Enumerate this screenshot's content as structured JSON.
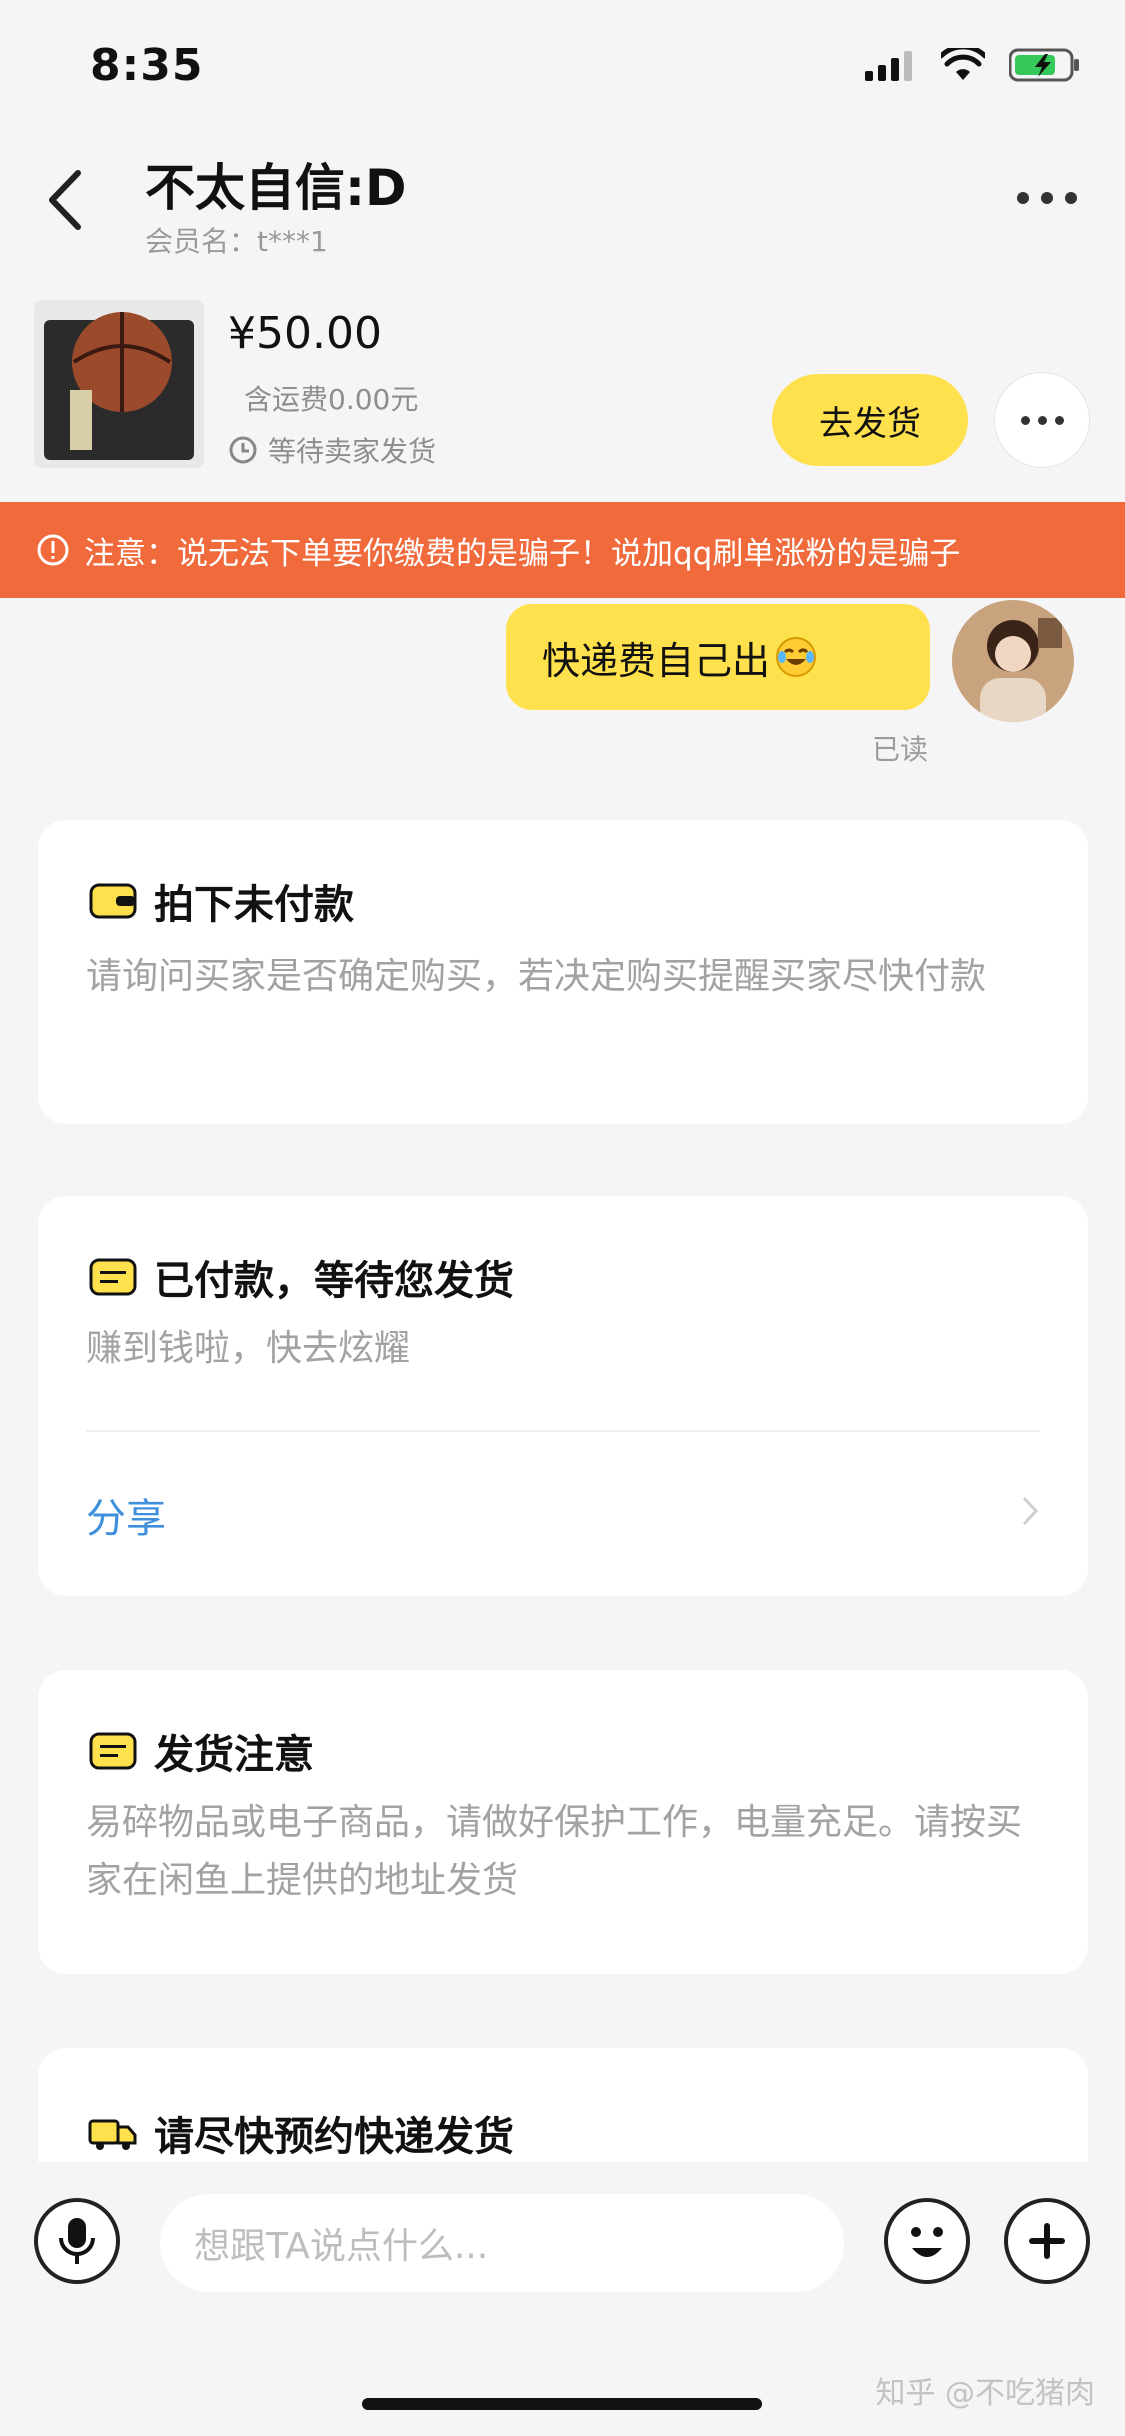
{
  "status": {
    "time": "8:35"
  },
  "header": {
    "title": "不太自信:D",
    "member_label": "会员名：t***1"
  },
  "product": {
    "price": "¥50.00",
    "shipping": "含运费0.00元",
    "status": "等待卖家发货",
    "ship_button": "去发货"
  },
  "warning": {
    "text": "注意：说无法下单要你缴费的是骗子！说加qq刷单涨粉的是骗子"
  },
  "chat": {
    "message": "快递费自己出",
    "read": "已读"
  },
  "cards": [
    {
      "title": "拍下未付款",
      "desc": "请询问买家是否确定购买，若决定购买提醒买家尽快付款"
    },
    {
      "title": "已付款，等待您发货",
      "desc": "赚到钱啦，快去炫耀",
      "link": "分享"
    },
    {
      "title": "发货注意",
      "desc": "易碎物品或电子商品，请做好保护工作，电量充足。请按买家在闲鱼上提供的地址发货"
    },
    {
      "title": "请尽快预约快递发货"
    }
  ],
  "input": {
    "placeholder": "想跟TA说点什么..."
  },
  "watermark": "知乎 @不吃猪肉",
  "colors": {
    "accent_yellow": "#ffe14d",
    "warning_orange": "#f06a3c",
    "link_blue": "#3f8fdc"
  }
}
